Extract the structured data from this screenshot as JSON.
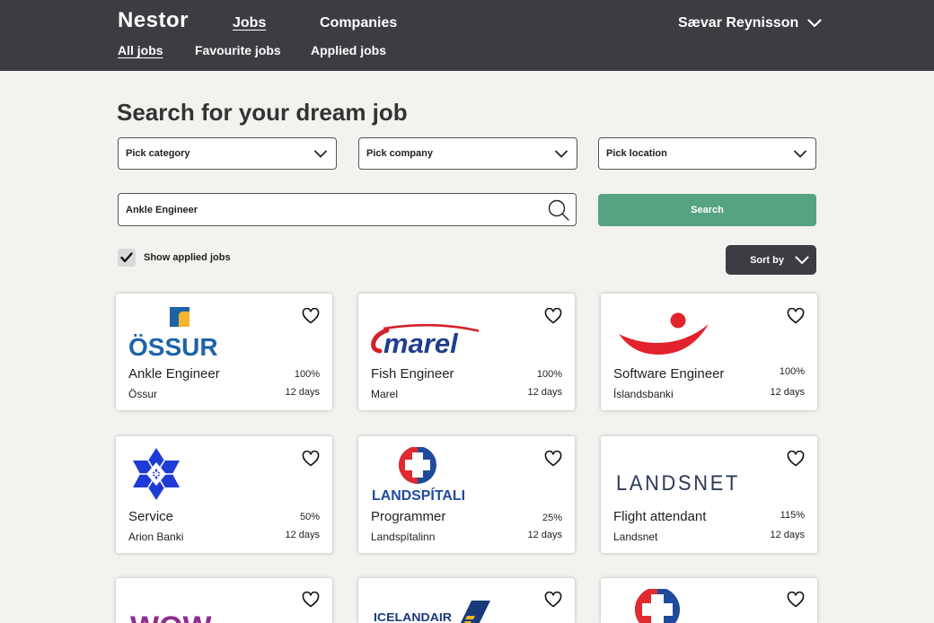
{
  "header": {
    "brand": "Nestor",
    "nav": {
      "jobs": "Jobs",
      "companies": "Companies"
    },
    "user": "Sævar Reynisson",
    "sub_nav": {
      "all": "All jobs",
      "favourite": "Favourite jobs",
      "applied": "Applied jobs"
    }
  },
  "search": {
    "title": "Search for your dream job",
    "category_placeholder": "Pick category",
    "company_placeholder": "Pick company",
    "location_placeholder": "Pick location",
    "query_value": "Ankle Engineer",
    "search_label": "Search",
    "show_applied_label": "Show applied jobs",
    "show_applied_checked": true,
    "sort_label": "Sort by"
  },
  "jobs": [
    {
      "title": "Ankle Engineer",
      "company": "Össur",
      "percent": "100%",
      "days": "12 days",
      "logo": "ossur-logo",
      "logo_text": "ÖSSUR"
    },
    {
      "title": "Fish Engineer",
      "company": "Marel",
      "percent": "100%",
      "days": "12 days",
      "logo": "marel-logo",
      "logo_text": "marel"
    },
    {
      "title": "Software Engineer",
      "company": "Íslandsbanki",
      "percent": "100%",
      "days": "12 days",
      "logo": "islandsbanki-logo"
    },
    {
      "title": "Service",
      "company": "Arion Banki",
      "percent": "50%",
      "days": "12 days",
      "logo": "arion-logo"
    },
    {
      "title": "Programmer",
      "company": "Landspítalinn",
      "percent": "25%",
      "days": "12 days",
      "logo": "landspitali-logo",
      "logo_text": "LANDSPÍTALI"
    },
    {
      "title": "Flight attendant",
      "company": "Landsnet",
      "percent": "115%",
      "days": "12 days",
      "logo": "landsnet-logo",
      "logo_text": "LANDSNET"
    },
    {
      "logo": "wow-logo",
      "logo_text": "WOW"
    },
    {
      "logo": "icelandair-logo",
      "logo_text": "ICELANDAIR"
    },
    {
      "logo": "landspitali-logo"
    }
  ],
  "colors": {
    "header_bg": "#3b3d42",
    "page_bg": "#f2f2ef",
    "search_button": "#56a381",
    "ossur_blue": "#1e63a8",
    "ossur_yellow": "#f2b530",
    "marel_red": "#d6202a",
    "marel_blue": "#1f3f8c",
    "islandsbanki_red": "#e2222c",
    "arion_blue": "#1f3bd6",
    "landspitali_blue": "#1f4a9c",
    "landspitali_red": "#e02a2f",
    "landsnet_navy": "#2b3a55",
    "wow_purple": "#8e2d8e",
    "icelandair_blue": "#1a3a7a",
    "icelandair_yellow": "#f0b422"
  },
  "icons": {
    "user_menu": "chevron-down-icon",
    "dropdown": "chevron-down-icon",
    "search": "search-icon",
    "checkbox": "checkmark-icon",
    "sort": "chevron-down-icon",
    "favourite": "heart-outline-icon"
  }
}
